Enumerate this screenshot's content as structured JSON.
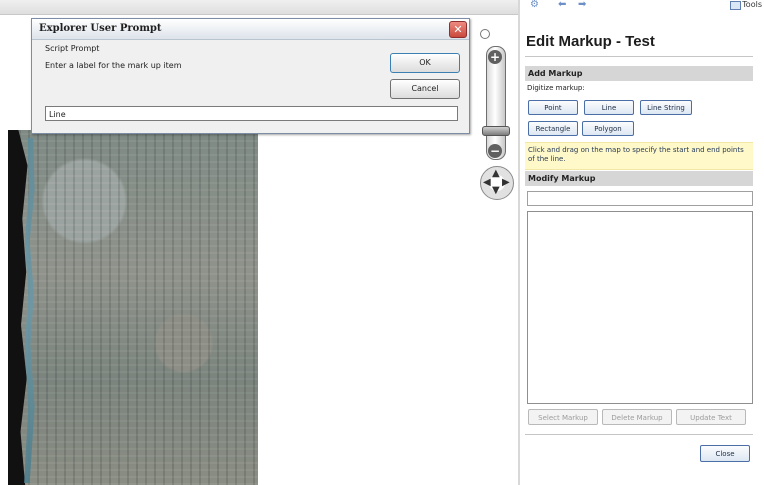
{
  "dialog": {
    "title": "Explorer User Prompt",
    "subtitle": "Script Prompt",
    "message": "Enter a label for the mark up item",
    "input_value": "Line",
    "ok_label": "OK",
    "cancel_label": "Cancel",
    "close_glyph": "✕"
  },
  "panel": {
    "tools_label": "Tools",
    "title": "Edit Markup - Test",
    "add_section": "Add Markup",
    "digitize_label": "Digitize markup:",
    "buttons": {
      "point": "Point",
      "line": "Line",
      "line_string": "Line String",
      "rectangle": "Rectangle",
      "polygon": "Polygon"
    },
    "help_text": "Click and drag on the map to specify the start and end points of the line.",
    "modify_section": "Modify Markup",
    "action_buttons": {
      "select": "Select Markup",
      "delete": "Delete Markup",
      "update": "Update Text"
    },
    "close_label": "Close"
  },
  "icons": {
    "toolbar": [
      "settings-icon",
      "back-arrow-icon",
      "forward-arrow-icon"
    ],
    "zoom": [
      "search-icon",
      "zoom-in-icon",
      "zoom-out-icon",
      "pan-icon"
    ]
  },
  "colors": {
    "dialog_background": "#f0f0f0",
    "close_button": "#c9493c",
    "section_header": "#d6d6d6",
    "help_background": "#fff8c8",
    "button_border": "#4a6ea5"
  }
}
